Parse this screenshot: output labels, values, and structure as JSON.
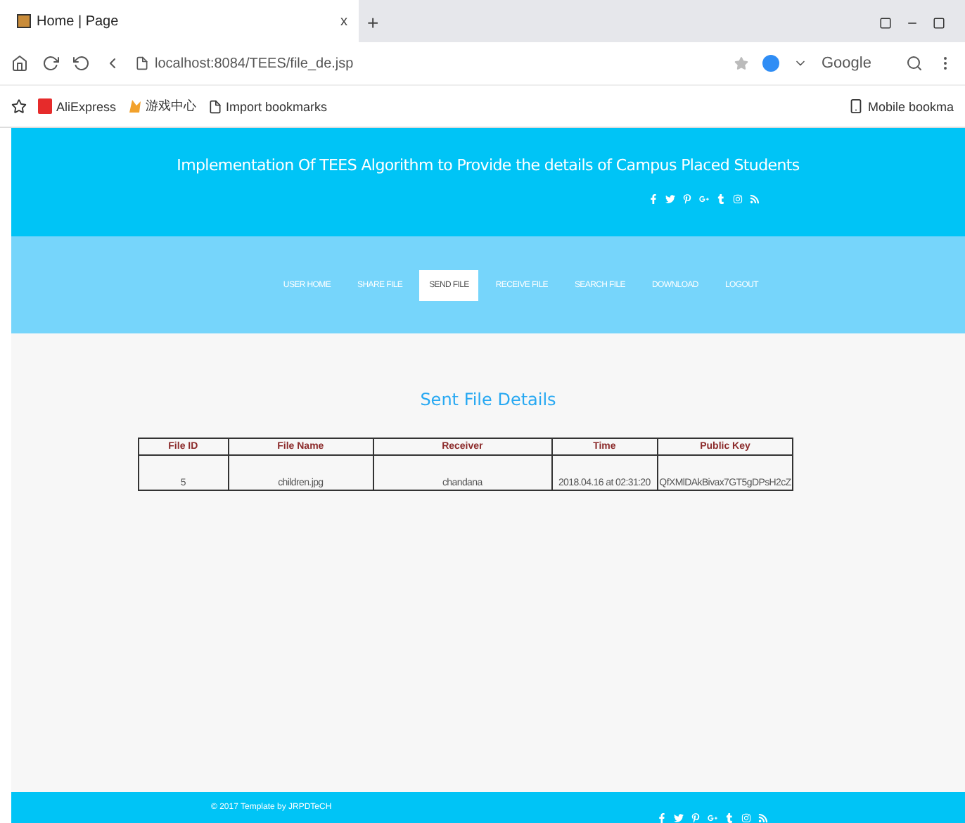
{
  "browser": {
    "tab_title": "Home | Page",
    "tab_close": "x",
    "new_tab": "+",
    "address": "localhost:8084/TEES/file_de.jsp",
    "search_engine": "Google",
    "bookmarks": [
      {
        "label": "AliExpress",
        "kind": "shop"
      },
      {
        "label": "游戏中心",
        "kind": "game"
      },
      {
        "label": "Import bookmarks",
        "kind": "import"
      }
    ],
    "mobile_bookmarks": "Mobile bookma"
  },
  "header": {
    "title": "Implementation Of TEES Algorithm to Provide the details of Campus Placed Students"
  },
  "nav": [
    {
      "label": "USER HOME",
      "selected": false
    },
    {
      "label": "SHARE FILE",
      "selected": false
    },
    {
      "label": "SEND FILE",
      "selected": true
    },
    {
      "label": "RECEIVE FILE",
      "selected": false
    },
    {
      "label": "SEARCH FILE",
      "selected": false
    },
    {
      "label": "DOWNLOAD",
      "selected": false
    },
    {
      "label": "LOGOUT",
      "selected": false
    }
  ],
  "content": {
    "heading": "Sent File Details",
    "table": {
      "columns": [
        "File ID",
        "File Name",
        "Receiver",
        "Time",
        "Public Key"
      ],
      "rows": [
        [
          "5",
          "children.jpg",
          "chandana",
          "2018.04.16 at 02:31:20",
          "QfXMlDAkBivax7GT5gDPsH2cZ"
        ]
      ]
    }
  },
  "footer": {
    "copyright": "© 2017 Template by JRPDTeCH"
  }
}
